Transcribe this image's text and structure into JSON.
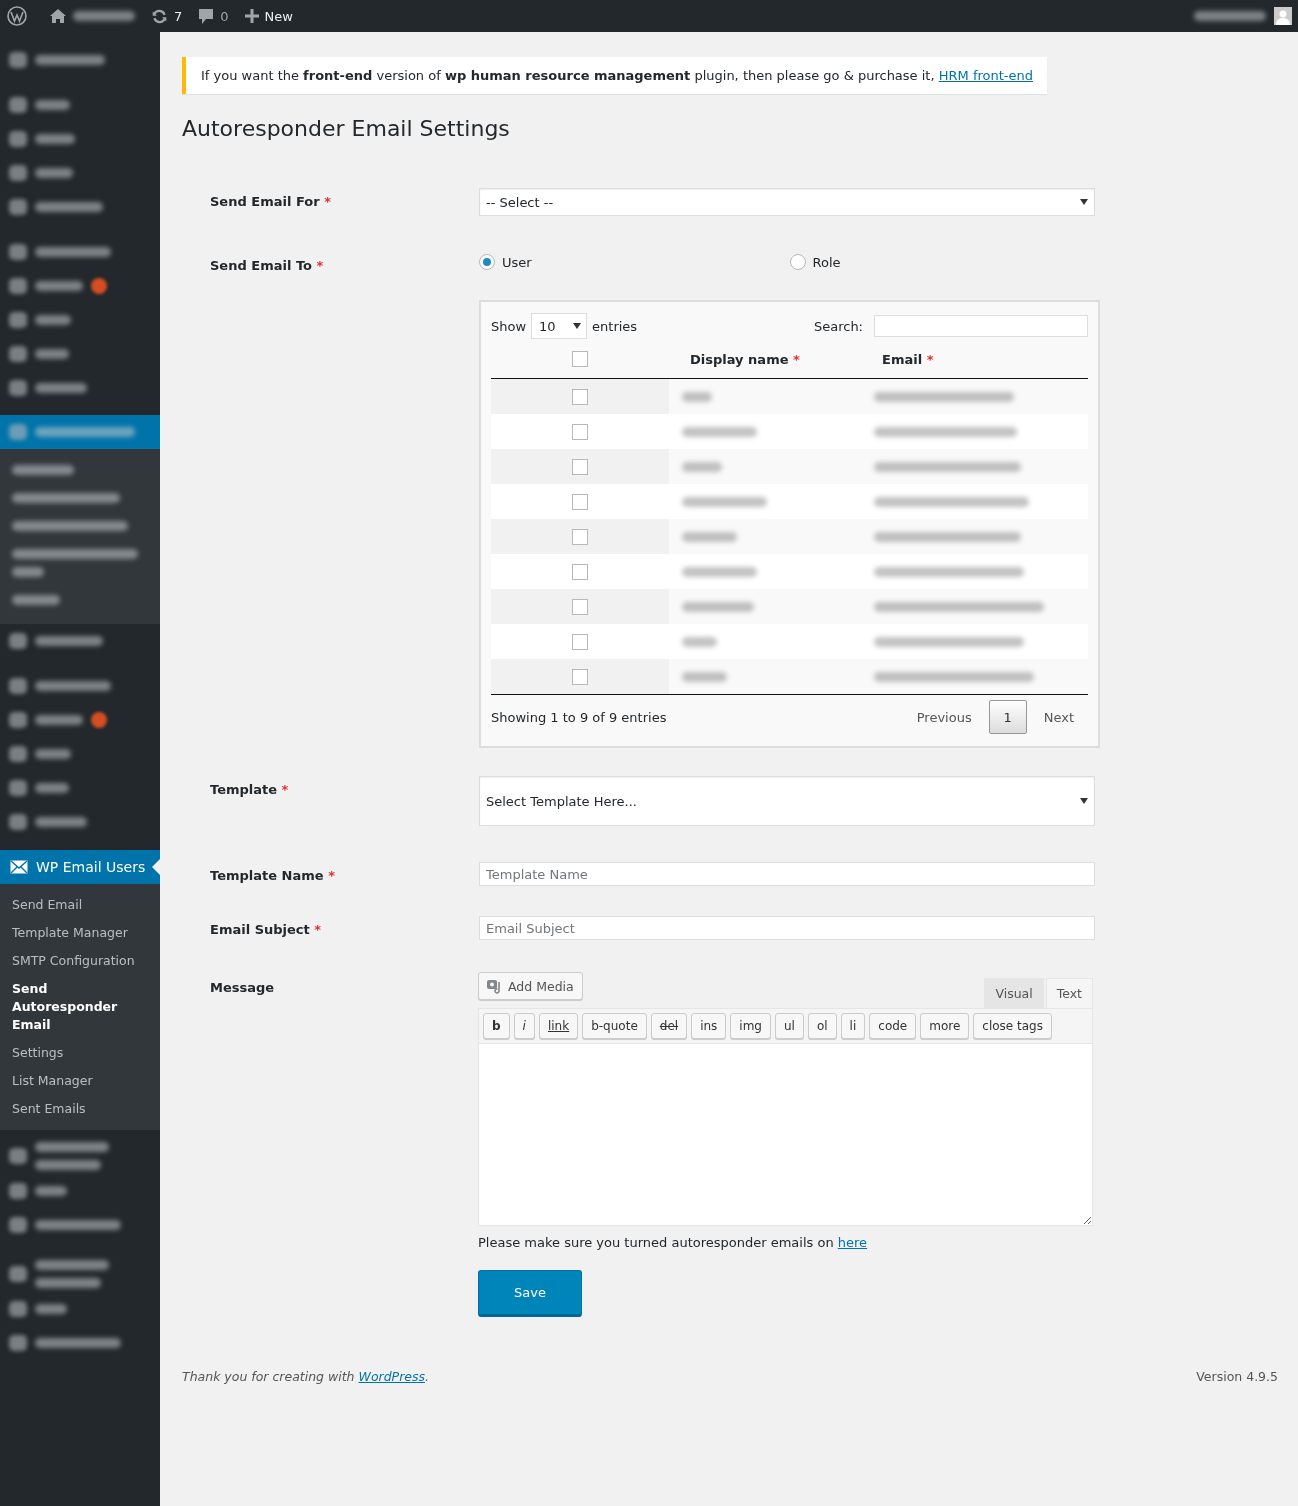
{
  "admin_bar": {
    "updates": "7",
    "comments": "0",
    "new": "New"
  },
  "sidebar": {
    "menu": {
      "label": "WP Email Users",
      "selected": true,
      "submenu": [
        {
          "label": "Send Email",
          "selected": false
        },
        {
          "label": "Template Manager",
          "selected": false
        },
        {
          "label": "SMTP Configuration",
          "selected": false
        },
        {
          "label": "Send Autoresponder Email",
          "selected": true
        },
        {
          "label": "Settings",
          "selected": false
        },
        {
          "label": "List Manager",
          "selected": false
        },
        {
          "label": "Sent Emails",
          "selected": false
        }
      ]
    }
  },
  "notice": {
    "text": "If you want the **front-end** version of **wp human resource management** plugin, then please go & purchase it,",
    "link": "HRM front-end"
  },
  "page_title": "Autoresponder Email Settings",
  "form": {
    "send_email_for": {
      "label": "Send Email For",
      "required_mark": "*",
      "value": "-- Select --"
    },
    "send_email_to": {
      "label": "Send Email To",
      "required_mark": "*",
      "options": [
        {
          "label": "User",
          "selected": true
        },
        {
          "label": "Role",
          "selected": false
        }
      ]
    },
    "users_table": {
      "show_label": "Show",
      "length_value": "10",
      "entries_label": "entries",
      "search_label": "Search:",
      "select_all_checked": false,
      "columns": [
        {
          "label": "Display name",
          "required_mark": "*"
        },
        {
          "label": "Email",
          "required_mark": "*"
        }
      ],
      "rows": [
        {
          "checked": false
        },
        {
          "checked": false
        },
        {
          "checked": false
        },
        {
          "checked": false
        },
        {
          "checked": false
        },
        {
          "checked": false
        },
        {
          "checked": false
        },
        {
          "checked": false
        },
        {
          "checked": false
        }
      ],
      "info": "Showing 1 to 9 of 9 entries",
      "previous": "Previous",
      "pages": [
        {
          "label": "1",
          "selected": true
        }
      ],
      "next": "Next"
    },
    "template": {
      "label": "Template",
      "required_mark": "*",
      "value": "Select Template Here..."
    },
    "template_name": {
      "label": "Template Name",
      "required_mark": "*",
      "placeholder": "Template Name"
    },
    "email_subject": {
      "label": "Email Subject",
      "required_mark": "*",
      "placeholder": "Email Subject"
    },
    "message": {
      "label": "Message",
      "add_media": "Add Media",
      "tabs": [
        {
          "label": "Visual",
          "selected": false
        },
        {
          "label": "Text",
          "selected": true
        }
      ],
      "toolbar": [
        {
          "label": "b",
          "kind": "bold"
        },
        {
          "label": "i",
          "kind": "italic"
        },
        {
          "label": "link",
          "kind": "underline"
        },
        {
          "label": "b-quote",
          "kind": "plain"
        },
        {
          "label": "del",
          "kind": "strike"
        },
        {
          "label": "ins",
          "kind": "plain"
        },
        {
          "label": "img",
          "kind": "plain"
        },
        {
          "label": "ul",
          "kind": "plain"
        },
        {
          "label": "ol",
          "kind": "plain"
        },
        {
          "label": "li",
          "kind": "plain"
        },
        {
          "label": "code",
          "kind": "plain"
        },
        {
          "label": "more",
          "kind": "plain"
        },
        {
          "label": "close tags",
          "kind": "plain"
        }
      ],
      "note": "Please make sure you turned autoresponder emails on",
      "note_link": "here"
    },
    "save": "Save"
  },
  "footer": {
    "text": "Thank you for creating with",
    "link": "WordPress",
    "after": ".",
    "version": "Version 4.9.5"
  }
}
